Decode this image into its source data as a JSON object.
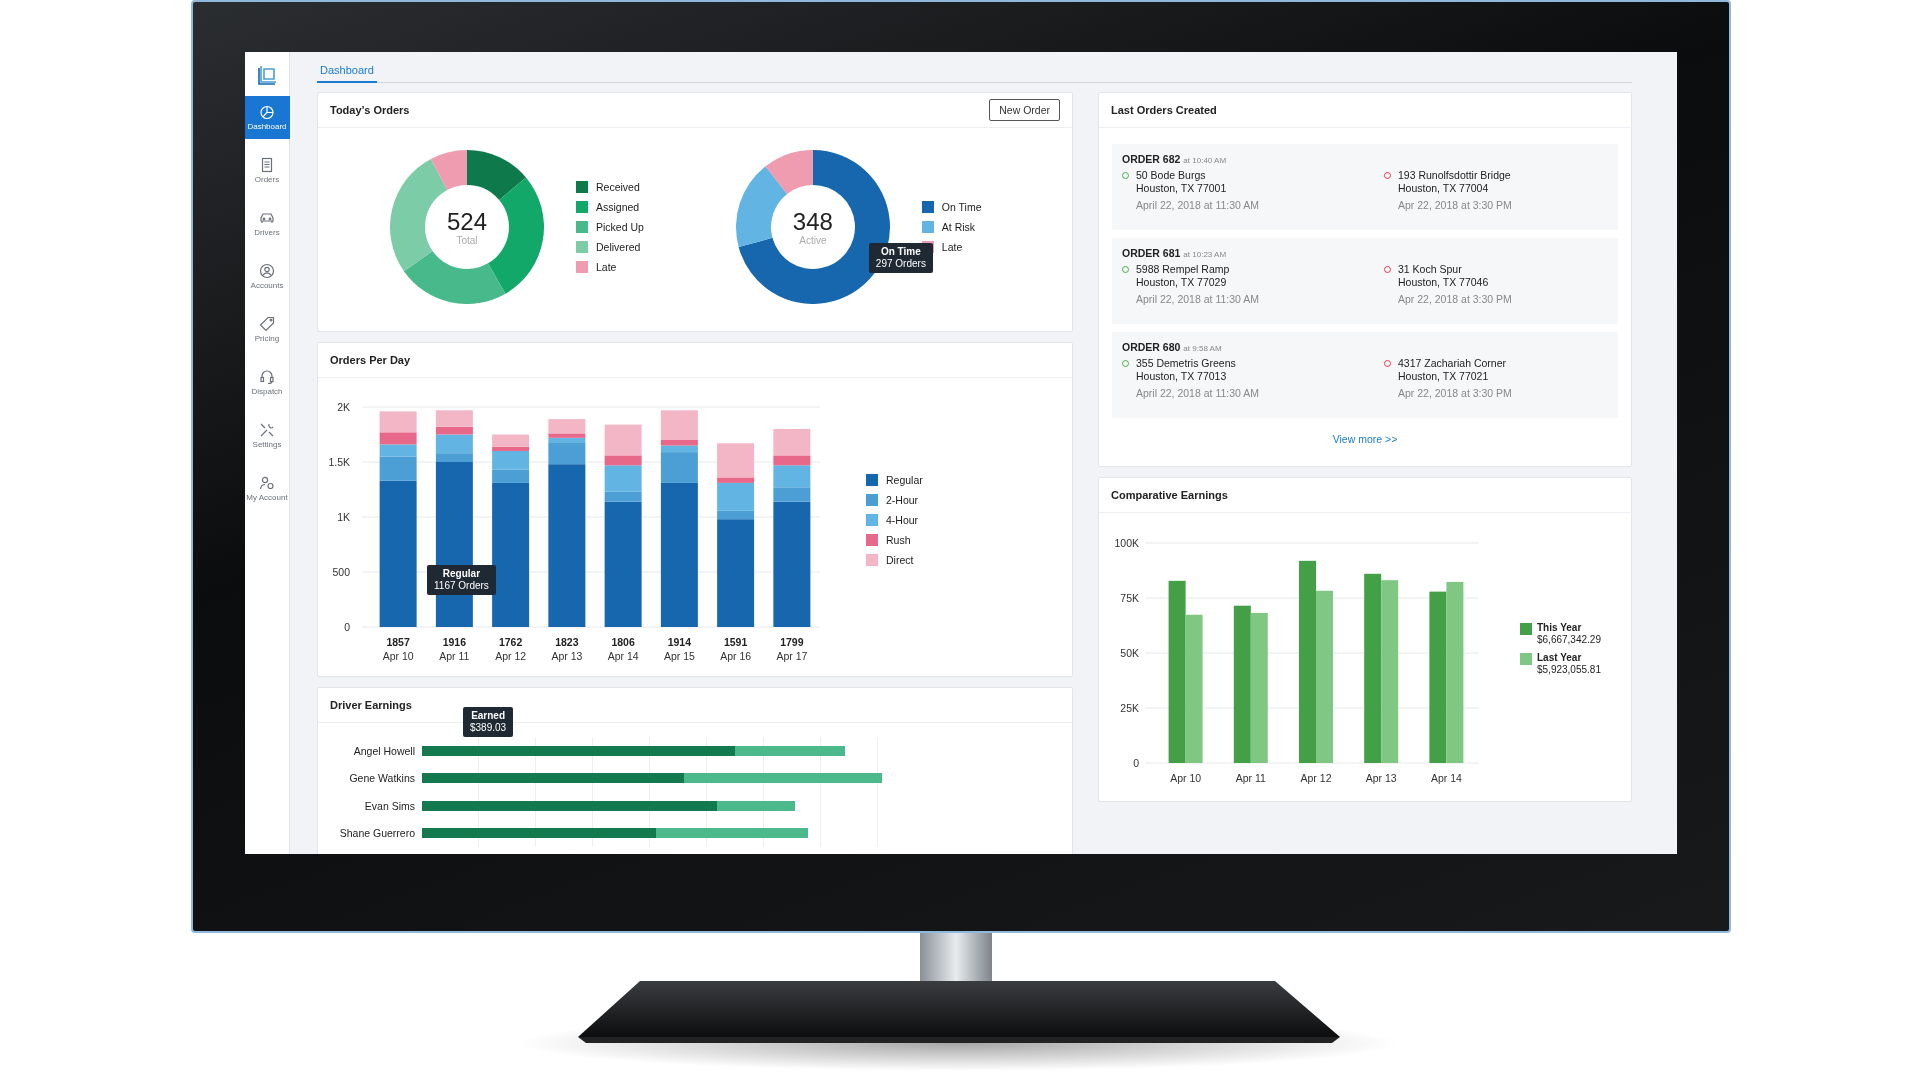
{
  "sidebar": {
    "items": [
      {
        "label": "Dashboard",
        "selected": true
      },
      {
        "label": "Orders",
        "selected": false
      },
      {
        "label": "Drivers",
        "selected": false
      },
      {
        "label": "Accounts",
        "selected": false
      },
      {
        "label": "Pricing",
        "selected": false
      },
      {
        "label": "Dispatch",
        "selected": false
      },
      {
        "label": "Settings",
        "selected": false
      },
      {
        "label": "My Account",
        "selected": false
      }
    ]
  },
  "tabs": [
    {
      "label": "Dashboard",
      "selected": true
    }
  ],
  "todays_orders": {
    "title": "Today’s Orders",
    "button": "New Order",
    "donuts": [
      {
        "value": "524",
        "caption": "Total",
        "legend": [
          {
            "label": "Received",
            "color": "#0e7a4c"
          },
          {
            "label": "Assigned",
            "color": "#12a86a"
          },
          {
            "label": "Picked Up",
            "color": "#47b98a"
          },
          {
            "label": "Delivered",
            "color": "#7dcca8"
          },
          {
            "label": "Late",
            "color": "#ef9bb0"
          }
        ]
      },
      {
        "value": "348",
        "caption": "Active",
        "legend": [
          {
            "label": "On Time",
            "color": "#1767ae"
          },
          {
            "label": "At Risk",
            "color": "#62b4e2"
          },
          {
            "label": "Late",
            "color": "#ef9bb0"
          }
        ],
        "tooltip": {
          "title": "On Time",
          "text": "297 Orders"
        }
      }
    ]
  },
  "orders_per_day": {
    "title": "Orders Per Day",
    "totals": [
      "1857",
      "1916",
      "1762",
      "1823",
      "1806",
      "1914",
      "1591",
      "1799"
    ],
    "tooltip": {
      "title": "Regular",
      "text": "1167 Orders"
    },
    "chart_data": {
      "type": "bar",
      "stacked": true,
      "grid": true,
      "categories": [
        "Apr 10",
        "Apr 11",
        "Apr 12",
        "Apr 13",
        "Apr 14",
        "Apr 15",
        "Apr 16",
        "Apr 17"
      ],
      "ylim": [
        0,
        2000
      ],
      "yticks": [
        {
          "value": 0,
          "label": "0"
        },
        {
          "value": 500,
          "label": "500"
        },
        {
          "value": 1000,
          "label": "1K"
        },
        {
          "value": 1500,
          "label": "1.5K"
        },
        {
          "value": 2000,
          "label": "2K"
        }
      ],
      "series": [
        {
          "name": "Regular",
          "color": "#1767ae",
          "values": [
            1330,
            1500,
            1310,
            1480,
            1140,
            1310,
            980,
            1140
          ]
        },
        {
          "name": "2-Hour",
          "color": "#4b9fd5",
          "values": [
            220,
            80,
            120,
            200,
            90,
            280,
            80,
            130
          ]
        },
        {
          "name": "4-Hour",
          "color": "#62b4e2",
          "values": [
            110,
            170,
            170,
            40,
            240,
            60,
            250,
            200
          ]
        },
        {
          "name": "Rush",
          "color": "#e8688a",
          "values": [
            110,
            70,
            40,
            40,
            90,
            50,
            50,
            90
          ]
        },
        {
          "name": "Direct",
          "color": "#f2b6c6",
          "values": [
            190,
            150,
            110,
            130,
            280,
            270,
            310,
            240
          ]
        }
      ]
    }
  },
  "driver_earnings": {
    "title": "Driver Earnings",
    "drivers": [
      "Angel Howell",
      "Gene Watkins",
      "Evan Sims",
      "Shane Guerrero"
    ],
    "tooltip": {
      "title": "Earned",
      "text": "$389.03"
    }
  },
  "last_orders": {
    "title": "Last Orders Created",
    "orders": [
      {
        "order": "ORDER 682",
        "time": "at 10:40 AM",
        "pickup": {
          "street": "50 Bode Burgs",
          "city": "Houston, TX 77001",
          "date": "April 22, 2018 at 11:30 AM"
        },
        "dropoff": {
          "street": "193 Runolfsdottir Bridge",
          "city": "Houston, TX 77004",
          "date": "Apr 22, 2018 at 3:30 PM"
        }
      },
      {
        "order": "ORDER 681",
        "time": "at 10:23 AM",
        "pickup": {
          "street": "5988 Rempel Ramp",
          "city": "Houston, TX 77029",
          "date": "April 22, 2018 at 11:30 AM"
        },
        "dropoff": {
          "street": "31 Koch Spur",
          "city": "Houston, TX 77046",
          "date": "Apr 22, 2018 at 3:30 PM"
        }
      },
      {
        "order": "ORDER 680",
        "time": "at 9:58 AM",
        "pickup": {
          "street": "355 Demetris Greens",
          "city": "Houston, TX 77013",
          "date": "April 22, 2018 at 11:30 AM"
        },
        "dropoff": {
          "street": "4317 Zachariah Corner",
          "city": "Houston, TX 77021",
          "date": "Apr 22, 2018 at 3:30 PM"
        }
      }
    ],
    "link": "View more >>"
  },
  "comparative_earnings": {
    "title": "Comparative Earnings",
    "totals": [
      "$6,667,342.29",
      "$5,923,055.81"
    ],
    "chart_data": {
      "type": "bar",
      "stacked": false,
      "grid": true,
      "categories": [
        "Apr 10",
        "Apr 11",
        "Apr 12",
        "Apr 13",
        "Apr 14"
      ],
      "ylim": [
        0,
        100000
      ],
      "yticks": [
        {
          "value": 0,
          "label": "0"
        },
        {
          "value": 25000,
          "label": "25K"
        },
        {
          "value": 50000,
          "label": "50K"
        },
        {
          "value": 75000,
          "label": "75K"
        },
        {
          "value": 100000,
          "label": "100K"
        }
      ],
      "series": [
        {
          "name": "This Year",
          "color": "#43a047",
          "values": [
            82800,
            71500,
            91900,
            86000,
            77900
          ]
        },
        {
          "name": "Last Year",
          "color": "#81c784",
          "values": [
            67400,
            68200,
            78300,
            83100,
            82300
          ]
        }
      ]
    }
  }
}
